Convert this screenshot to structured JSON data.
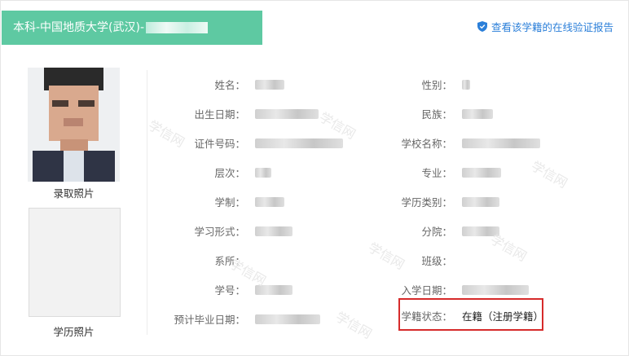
{
  "header": {
    "title": "本科-中国地质大学(武汉)-"
  },
  "verify_link": {
    "label": "查看该学籍的在线验证报告",
    "icon": "shield-check-icon",
    "color": "#2b7fd9"
  },
  "accent_color": "#5ec9a2",
  "photos": {
    "admission_label": "录取照片",
    "degree_label": "学历照片"
  },
  "left_fields": [
    {
      "label": "姓名：",
      "value": ""
    },
    {
      "label": "出生日期：",
      "value": ""
    },
    {
      "label": "证件号码：",
      "value": ""
    },
    {
      "label": "层次：",
      "value": ""
    },
    {
      "label": "学制：",
      "value": ""
    },
    {
      "label": "学习形式：",
      "value": ""
    },
    {
      "label": "系所：",
      "value": ""
    },
    {
      "label": "学号：",
      "value": ""
    },
    {
      "label": "预计毕业日期：",
      "value": ""
    }
  ],
  "right_fields": [
    {
      "label": "性别：",
      "value": ""
    },
    {
      "label": "民族：",
      "value": ""
    },
    {
      "label": "学校名称：",
      "value": ""
    },
    {
      "label": "专业：",
      "value": ""
    },
    {
      "label": "学历类别：",
      "value": ""
    },
    {
      "label": "分院：",
      "value": ""
    },
    {
      "label": "班级：",
      "value": ""
    },
    {
      "label": "入学日期：",
      "value": ""
    },
    {
      "label": "学籍状态：",
      "value": "在籍（注册学籍）"
    }
  ],
  "watermark": "学信网"
}
